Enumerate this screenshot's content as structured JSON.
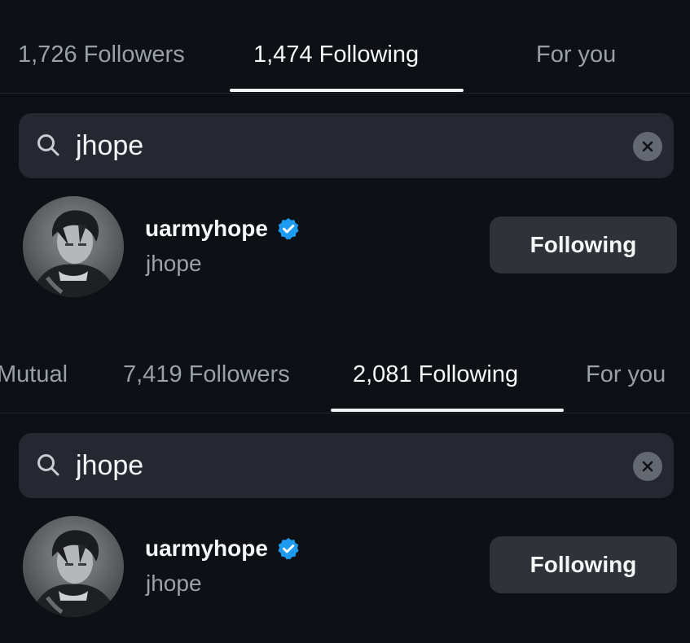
{
  "top_panel": {
    "tabs": [
      {
        "label": "1,726 Followers",
        "active": false
      },
      {
        "label": "1,474 Following",
        "active": true
      },
      {
        "label": "For you",
        "active": false
      }
    ],
    "search": {
      "value": "jhope"
    },
    "result": {
      "username": "uarmyhope",
      "name": "jhope",
      "verified": true,
      "button_label": "Following"
    }
  },
  "bottom_panel": {
    "tabs": [
      {
        "label": "Mutual",
        "active": false
      },
      {
        "label": "7,419 Followers",
        "active": false
      },
      {
        "label": "2,081 Following",
        "active": true
      },
      {
        "label": "For you",
        "active": false
      }
    ],
    "search": {
      "value": "jhope"
    },
    "result": {
      "username": "uarmyhope",
      "name": "jhope",
      "verified": true,
      "button_label": "Following"
    }
  },
  "icons": {
    "search": "search-icon",
    "clear": "close-circle-icon",
    "verified": "verified-badge-icon"
  },
  "colors": {
    "background": "#0d1015",
    "verified_blue": "#1d9bf0",
    "button_bg": "#2f3238",
    "search_bg": "#252830"
  }
}
